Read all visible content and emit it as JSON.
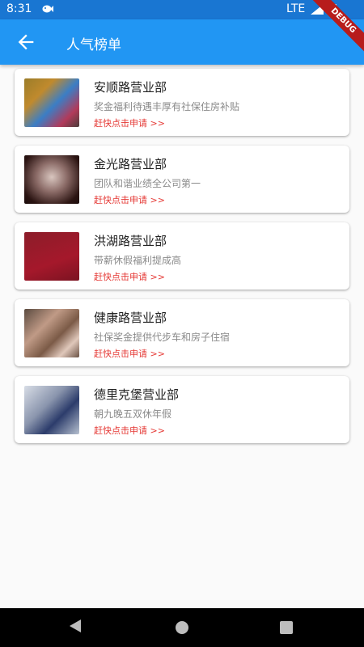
{
  "status_bar": {
    "time": "8:31",
    "network": "LTE",
    "notification_icon": "notification-icon",
    "signal_icon": "signal-icon",
    "battery_icon": "battery-icon"
  },
  "app_bar": {
    "title": "人气榜单",
    "back_icon": "arrow-back-icon",
    "color": "#2196f3"
  },
  "debug_banner": "DEBUG",
  "items": [
    {
      "title": "安顺路营业部",
      "desc": "奖金福利待遇丰厚有社保住房补贴",
      "apply": "赶快点击申请 >>"
    },
    {
      "title": "金光路营业部",
      "desc": "团队和谐业绩全公司第一",
      "apply": "赶快点击申请 >>"
    },
    {
      "title": "洪湖路营业部",
      "desc": "带薪休假福利提成高",
      "apply": "赶快点击申请 >>"
    },
    {
      "title": "健康路营业部",
      "desc": "社保奖金提供代步车和房子住宿",
      "apply": "赶快点击申请 >>"
    },
    {
      "title": "德里克堡营业部",
      "desc": "朝九晚五双休年假",
      "apply": "赶快点击申请 >>"
    }
  ],
  "colors": {
    "accent": "#2196f3",
    "apply_text": "#e53935"
  }
}
